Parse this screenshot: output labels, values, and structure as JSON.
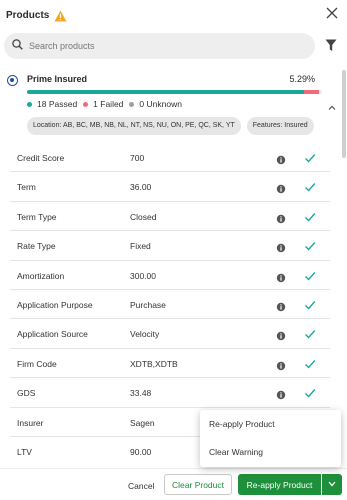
{
  "header": {
    "title": "Products"
  },
  "search": {
    "placeholder": "Search products"
  },
  "product": {
    "name": "Prime Insured",
    "match_percent": "5.29%",
    "progress": {
      "passed_fraction": 0.94,
      "failed_fraction": 0.05
    },
    "stats": [
      {
        "label": "18 Passed",
        "color": "#1aa89d"
      },
      {
        "label": "1 Failed",
        "color": "#f26a7a"
      },
      {
        "label": "0 Unknown",
        "color": "#9e9e9e"
      }
    ],
    "tags": [
      "Location: AB, BC, MB, NB, NL, NT, NS, NU, ON, PE, QC, SK, YT",
      "Features: Insured"
    ]
  },
  "criteria": [
    {
      "label": "Credit Score",
      "value": "700"
    },
    {
      "label": "Term",
      "value": "36.00"
    },
    {
      "label": "Term Type",
      "value": "Closed"
    },
    {
      "label": "Rate Type",
      "value": "Fixed"
    },
    {
      "label": "Amortization",
      "value": "300.00"
    },
    {
      "label": "Application Purpose",
      "value": "Purchase"
    },
    {
      "label": "Application Source",
      "value": "Velocity"
    },
    {
      "label": "Firm Code",
      "value": "XDTB,XDTB"
    },
    {
      "label": "GDS",
      "value": "33.48"
    },
    {
      "label": "Insurer",
      "value": "Sagen"
    },
    {
      "label": "LTV",
      "value": "90.00"
    }
  ],
  "popup": {
    "items": [
      "Re-apply Product",
      "Clear Warning"
    ]
  },
  "footer": {
    "cancel_label": "Cancel",
    "clear_label": "Clear Product",
    "reapply_label": "Re-apply Product"
  },
  "colors": {
    "accent_green": "#1e8f3a",
    "check_teal": "#1aa89d",
    "warning_orange": "#f5a623",
    "radio_blue": "#1e4fa3"
  },
  "icons": [
    "warning-icon",
    "close-icon",
    "search-icon",
    "filter-icon",
    "chevron-up-icon",
    "info-icon",
    "check-icon",
    "chevron-down-icon"
  ]
}
